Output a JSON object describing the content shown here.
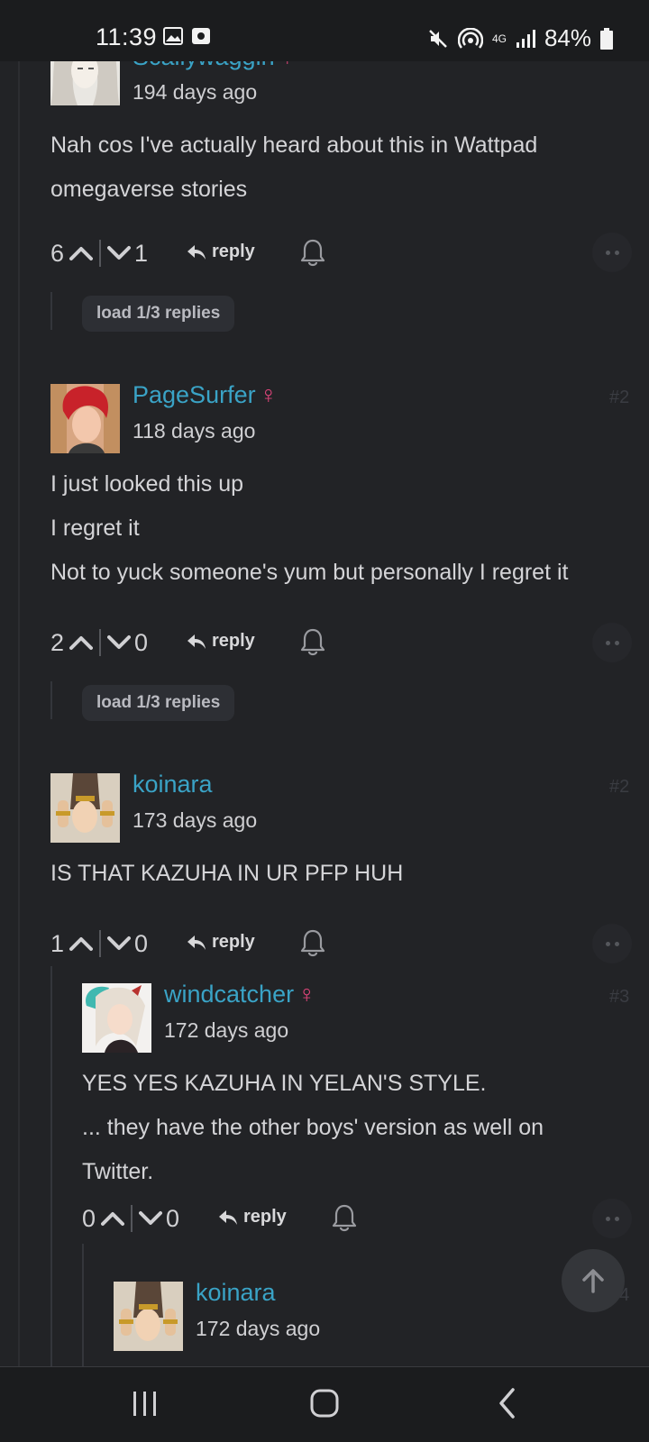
{
  "status_bar": {
    "time": "11:39",
    "network": "4G",
    "battery": "84%",
    "icons": [
      "gallery-icon",
      "screen-record-icon",
      "mute-icon",
      "hotspot-icon",
      "network-4g-icon",
      "signal-icon",
      "battery-icon"
    ]
  },
  "comments": [
    {
      "username": "Scallywaggin",
      "gender": "♀",
      "age": "194 days ago",
      "lines": [
        "Nah cos I've actually heard about this in Wattpad",
        "omegaverse stories"
      ],
      "upvotes": "6",
      "downvotes": "1",
      "reply_label": "reply",
      "load_replies": "load 1/3 replies"
    },
    {
      "username": "PageSurfer",
      "gender": "♀",
      "index": "#2",
      "age": "118 days ago",
      "lines": [
        "I just looked this up",
        "I regret it",
        "Not to yuck someone's yum but personally I regret it"
      ],
      "upvotes": "2",
      "downvotes": "0",
      "reply_label": "reply",
      "load_replies": "load 1/3 replies"
    },
    {
      "username": "koinara",
      "gender": "",
      "index": "#2",
      "age": "173 days ago",
      "lines": [
        "IS THAT KAZUHA IN UR PFP HUH"
      ],
      "upvotes": "1",
      "downvotes": "0",
      "reply_label": "reply"
    },
    {
      "username": "windcatcher",
      "gender": "♀",
      "index": "#3",
      "age": "172 days ago",
      "lines": [
        "YES YES KAZUHA IN YELAN'S STYLE.",
        "... they have the other boys' version as well on",
        "Twitter."
      ],
      "upvotes": "0",
      "downvotes": "0",
      "reply_label": "reply"
    },
    {
      "username": "koinara",
      "gender": "",
      "index": "#4",
      "age": "172 days ago"
    }
  ],
  "colors": {
    "background": "#222326",
    "username": "#3aa3c6",
    "gender": "#e0457b",
    "text": "#d4d4d7"
  }
}
